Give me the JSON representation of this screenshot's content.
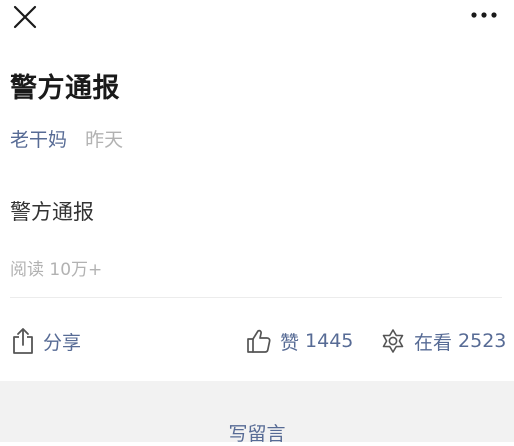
{
  "topbar": {
    "close_icon": "close-icon",
    "more_icon": "more-icon"
  },
  "article": {
    "title": "警方通报",
    "author": "老干妈",
    "date": "昨天",
    "body": "警方通报",
    "read_count": "阅读 10万+"
  },
  "actions": {
    "share_label": "分享",
    "like_label": "赞",
    "like_count": "1445",
    "wow_label": "在看",
    "wow_count": "2523"
  },
  "comment": {
    "write_label": "写留言"
  },
  "colors": {
    "link": "#576b95",
    "muted": "#b2b2b2",
    "text": "#1a1a1a",
    "bottom_bg": "#f2f2f2"
  }
}
